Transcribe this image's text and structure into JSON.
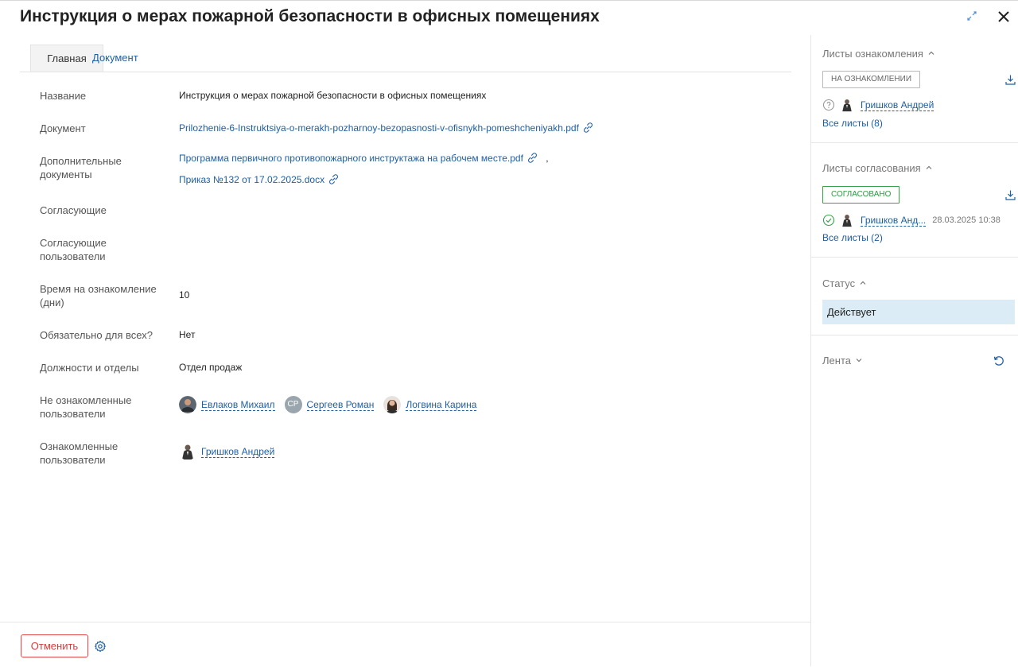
{
  "header": {
    "title": "Инструкция о мерах пожарной безопасности в офисных помещениях"
  },
  "tabs": [
    {
      "label": "Главная",
      "active": true
    },
    {
      "label": "Документ",
      "active": false
    }
  ],
  "fields": {
    "name": {
      "label": "Название",
      "value": "Инструкция о мерах пожарной безопасности в офисных помещениях"
    },
    "document": {
      "label": "Документ",
      "value": "Prilozhenie-6-Instruktsiya-o-merakh-pozharnoy-bezopasnosti-v-ofisnykh-pomeshcheniyakh.pdf"
    },
    "extra_docs": {
      "label": "Дополнительные документы",
      "items": [
        "Программа первичного противопожарного инструктажа на рабочем месте.pdf",
        "Приказ №132 от 17.02.2025.docx"
      ],
      "separator": ","
    },
    "approvers": {
      "label": "Согласующие"
    },
    "approver_users": {
      "label": "Согласующие пользователи"
    },
    "review_time": {
      "label": "Время на ознакомление (дни)",
      "value": "10"
    },
    "mandatory": {
      "label": "Обязательно для всех?",
      "value": "Нет"
    },
    "positions": {
      "label": "Должности и отделы",
      "value": "Отдел продаж"
    },
    "not_acquainted": {
      "label": "Не ознакомленные пользователи",
      "users": [
        {
          "name": "Евлаков Михаил",
          "initials": ""
        },
        {
          "name": "Сергеев Роман",
          "initials": "СР"
        },
        {
          "name": "Логвина Карина",
          "initials": ""
        }
      ]
    },
    "acquainted": {
      "label": "Ознакомленные пользователи",
      "users": [
        {
          "name": "Гришков Андрей"
        }
      ]
    }
  },
  "footer": {
    "cancel_label": "Отменить"
  },
  "sidebar": {
    "acquaintance": {
      "title": "Листы ознакомления",
      "badge": "НА ОЗНАКОМЛЕНИИ",
      "user": "Гришков Андрей",
      "all_link": "Все листы (8)"
    },
    "approval": {
      "title": "Листы согласования",
      "badge": "СОГЛАСОВАНО",
      "user": "Гришков Анд...",
      "date": "28.03.2025 10:38",
      "all_link": "Все листы (2)"
    },
    "status": {
      "title": "Статус",
      "value": "Действует"
    },
    "feed": {
      "title": "Лента"
    }
  },
  "colors": {
    "link": "#1f5fa1",
    "cancel": "#e04848",
    "approved": "#38a24a",
    "status_bg": "#dcecf6"
  }
}
